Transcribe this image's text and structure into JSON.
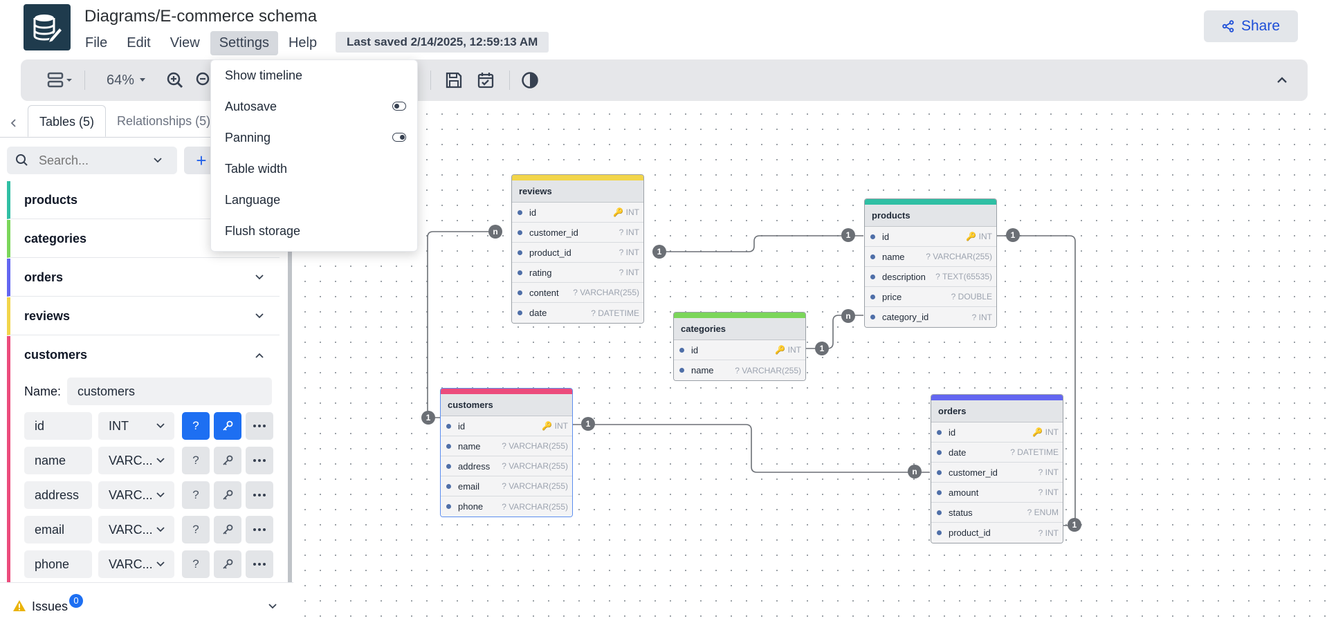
{
  "app": {
    "title": "Diagrams/E-commerce schema",
    "last_saved": "Last saved 2/14/2025, 12:59:13 AM",
    "share_label": "Share",
    "accent_color": "#1d6ff2"
  },
  "menu": [
    "File",
    "Edit",
    "View",
    "Settings",
    "Help"
  ],
  "settings_menu": {
    "items": [
      "Show timeline",
      "Autosave",
      "Panning",
      "Table width",
      "Language",
      "Flush storage"
    ],
    "autosave_on": false,
    "panning_on": true
  },
  "toolbar": {
    "zoom": "64%",
    "icons": [
      "layout-icon",
      "zoom-in-icon",
      "zoom-out-icon",
      "save-icon",
      "calendar-check-icon",
      "theme-toggle-icon",
      "chevron-up-icon"
    ]
  },
  "sidebar": {
    "tabs": [
      "Tables (5)",
      "Relationships (5)"
    ],
    "search_placeholder": "Search...",
    "add_label": "+",
    "tables": [
      {
        "name": "products",
        "color": "#2fbfa4"
      },
      {
        "name": "categories",
        "color": "#7bd65a"
      },
      {
        "name": "orders",
        "color": "#6366f1"
      },
      {
        "name": "reviews",
        "color": "#f2d54a"
      },
      {
        "name": "customers",
        "color": "#ec4b7c"
      }
    ],
    "editor": {
      "name_label": "Name:",
      "name_value": "customers",
      "fields": [
        {
          "name": "id",
          "type": "INT",
          "nullable_on": true,
          "pk_on": true
        },
        {
          "name": "name",
          "type": "VARC...",
          "nullable_on": false,
          "pk_on": false
        },
        {
          "name": "address",
          "type": "VARC...",
          "nullable_on": false,
          "pk_on": false
        },
        {
          "name": "email",
          "type": "VARC...",
          "nullable_on": false,
          "pk_on": false
        },
        {
          "name": "phone",
          "type": "VARC...",
          "nullable_on": false,
          "pk_on": false
        }
      ],
      "question_label": "?",
      "more_label": "..."
    },
    "issues_label": "Issues",
    "issues_count": "0"
  },
  "diagram": {
    "tables": [
      {
        "id": "reviews",
        "title": "reviews",
        "color": "#f2d54a",
        "fields": [
          [
            "id",
            "🔑 INT"
          ],
          [
            "customer_id",
            "? INT"
          ],
          [
            "product_id",
            "? INT"
          ],
          [
            "rating",
            "? INT"
          ],
          [
            "content",
            "? VARCHAR(255)"
          ],
          [
            "date",
            "? DATETIME"
          ]
        ]
      },
      {
        "id": "products",
        "title": "products",
        "color": "#2fbfa4",
        "fields": [
          [
            "id",
            "🔑 INT"
          ],
          [
            "name",
            "? VARCHAR(255)"
          ],
          [
            "description",
            "? TEXT(65535)"
          ],
          [
            "price",
            "? DOUBLE"
          ],
          [
            "category_id",
            "? INT"
          ]
        ]
      },
      {
        "id": "categories",
        "title": "categories",
        "color": "#7bd65a",
        "fields": [
          [
            "id",
            "🔑 INT"
          ],
          [
            "name",
            "? VARCHAR(255)"
          ]
        ]
      },
      {
        "id": "customers",
        "title": "customers",
        "color": "#ec4b7c",
        "fields": [
          [
            "id",
            "🔑 INT"
          ],
          [
            "name",
            "? VARCHAR(255)"
          ],
          [
            "address",
            "? VARCHAR(255)"
          ],
          [
            "email",
            "? VARCHAR(255)"
          ],
          [
            "phone",
            "? VARCHAR(255)"
          ]
        ]
      },
      {
        "id": "orders",
        "title": "orders",
        "color": "#6366f1",
        "fields": [
          [
            "id",
            "🔑 INT"
          ],
          [
            "date",
            "? DATETIME"
          ],
          [
            "customer_id",
            "? INT"
          ],
          [
            "amount",
            "? INT"
          ],
          [
            "status",
            "? ENUM"
          ],
          [
            "product_id",
            "? INT"
          ]
        ]
      }
    ],
    "markers": {
      "one": "1",
      "many": "n"
    }
  }
}
